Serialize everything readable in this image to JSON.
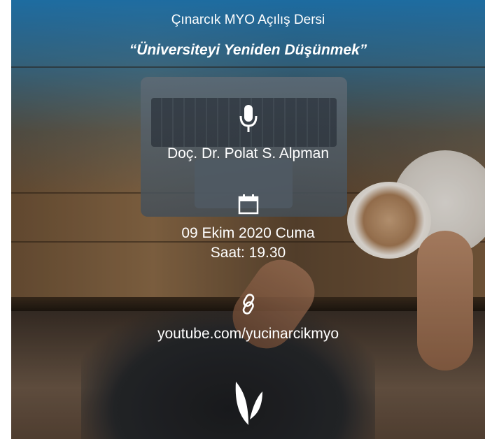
{
  "event": {
    "title": "Çınarcık MYO Açılış Dersi",
    "subtitle": "“Üniversiteyi Yeniden Düşünmek”",
    "speaker": "Doç. Dr. Polat S. Alpman",
    "date": "09 Ekim 2020 Cuma",
    "time": "Saat: 19.30",
    "url": "youtube.com/yucinarcikmyo"
  },
  "icons": {
    "speaker": "microphone-icon",
    "date": "calendar-icon",
    "link": "link-icon",
    "logo": "leaf-logo-icon"
  },
  "colors": {
    "text": "#ffffff",
    "top_gradient": "#1e7dbe"
  }
}
